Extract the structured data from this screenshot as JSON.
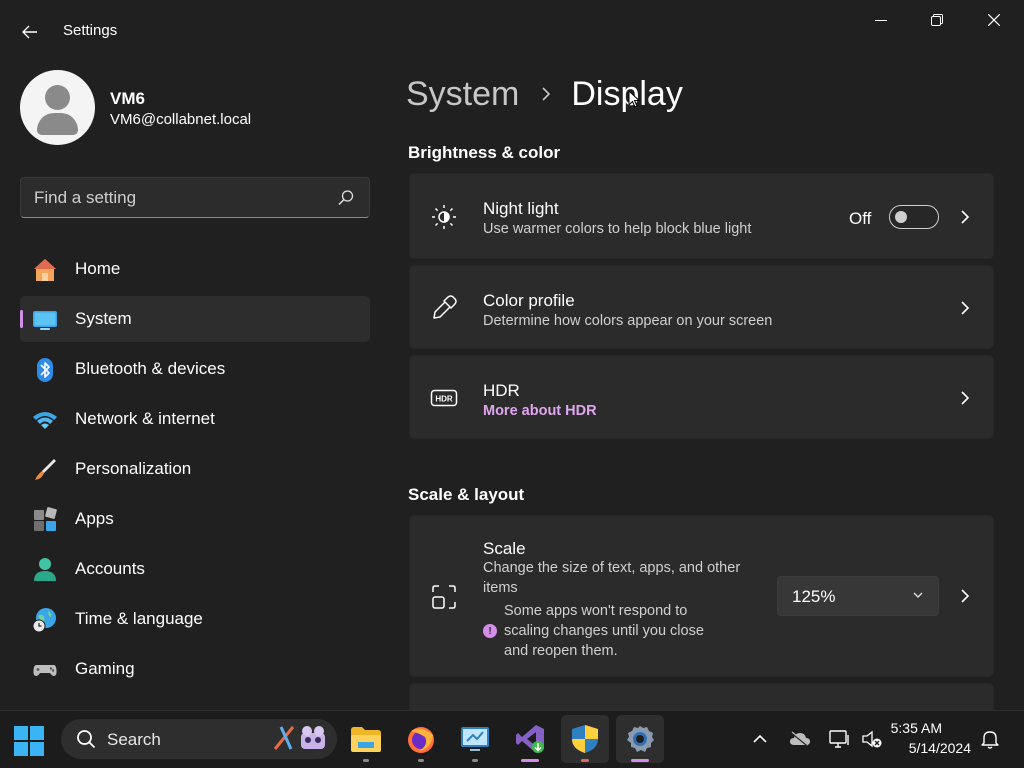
{
  "window": {
    "title": "Settings"
  },
  "profile": {
    "name": "VM6",
    "email": "VM6@collabnet.local"
  },
  "search": {
    "placeholder": "Find a setting"
  },
  "nav": {
    "items": [
      {
        "label": "Home",
        "icon": "home-icon"
      },
      {
        "label": "System",
        "icon": "system-icon",
        "active": true
      },
      {
        "label": "Bluetooth & devices",
        "icon": "bluetooth-icon"
      },
      {
        "label": "Network & internet",
        "icon": "wifi-icon"
      },
      {
        "label": "Personalization",
        "icon": "brush-icon"
      },
      {
        "label": "Apps",
        "icon": "apps-icon"
      },
      {
        "label": "Accounts",
        "icon": "accounts-icon"
      },
      {
        "label": "Time & language",
        "icon": "globe-clock-icon"
      },
      {
        "label": "Gaming",
        "icon": "gamepad-icon"
      }
    ]
  },
  "breadcrumb": {
    "parent": "System",
    "current": "Display"
  },
  "sections": {
    "brightness": {
      "title": "Brightness & color",
      "night_light": {
        "title": "Night light",
        "subtitle": "Use warmer colors to help block blue light",
        "state": "Off"
      },
      "color_profile": {
        "title": "Color profile",
        "subtitle": "Determine how colors appear on your screen"
      },
      "hdr": {
        "title": "HDR",
        "link": "More about HDR"
      }
    },
    "scale_layout": {
      "title": "Scale & layout",
      "scale": {
        "title": "Scale",
        "subtitle_line1": "Change the size of text, apps, and other",
        "subtitle_line2": "items",
        "warning_line1": "Some apps won't respond to",
        "warning_line2": "scaling changes until you close",
        "warning_line3": "and reopen them.",
        "value": "125%"
      }
    }
  },
  "taskbar": {
    "search_label": "Search",
    "apps": [
      "file-explorer-icon",
      "firefox-icon",
      "remote-desktop-icon",
      "visual-studio-icon",
      "security-shield-icon",
      "settings-gear-icon"
    ],
    "time": "5:35 AM",
    "date": "5/14/2024"
  },
  "colors": {
    "accent": "#d58ee8",
    "background": "#202020",
    "card": "#2b2b2b",
    "link": "#e0a6f0"
  }
}
